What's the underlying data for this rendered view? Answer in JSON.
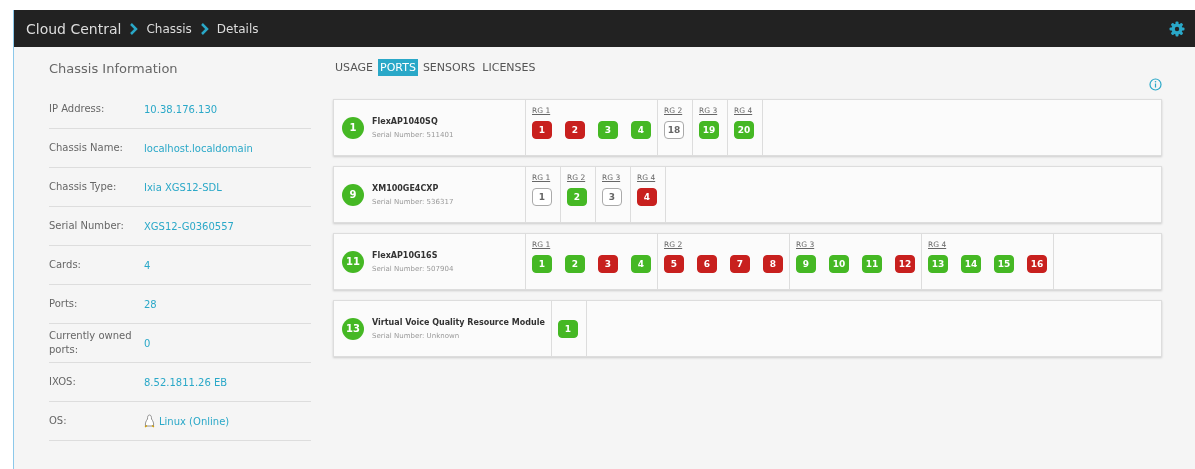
{
  "breadcrumb": [
    "Cloud Central",
    "Chassis",
    "Details"
  ],
  "info": {
    "title": "Chassis Information",
    "rows": [
      {
        "label": "IP Address:",
        "value": "10.38.176.130"
      },
      {
        "label": "Chassis Name:",
        "value": "localhost.localdomain"
      },
      {
        "label": "Chassis Type:",
        "value": "Ixia XGS12-SDL"
      },
      {
        "label": "Serial Number:",
        "value": "XGS12-G0360557"
      },
      {
        "label": "Cards:",
        "value": "4"
      },
      {
        "label": "Ports:",
        "value": "28"
      },
      {
        "label": "Currently owned ports:",
        "value": "0"
      },
      {
        "label": "IXOS:",
        "value": "8.52.1811.26 EB"
      },
      {
        "label": "OS:",
        "value": "Linux (Online)",
        "kind": "os"
      }
    ]
  },
  "tabs": [
    {
      "label": "USAGE",
      "selected": false
    },
    {
      "label": "PORTS",
      "selected": true
    },
    {
      "label": "SENSORS",
      "selected": false
    },
    {
      "label": "LICENSES",
      "selected": false
    }
  ],
  "cards": [
    {
      "slot": "1",
      "name": "FlexAP1040SQ",
      "serial": "Serial Number: 511401",
      "groups": [
        {
          "label": "RG 1",
          "ports": [
            {
              "number": "1",
              "kind": "down"
            },
            {
              "number": "2",
              "kind": "down"
            },
            {
              "number": "3",
              "kind": "up"
            },
            {
              "number": "4",
              "kind": "up"
            }
          ]
        },
        {
          "label": "RG 2",
          "ports": [
            {
              "number": "18",
              "kind": "idle"
            }
          ]
        },
        {
          "label": "RG 3",
          "ports": [
            {
              "number": "19",
              "kind": "up"
            }
          ]
        },
        {
          "label": "RG 4",
          "ports": [
            {
              "number": "20",
              "kind": "up"
            }
          ]
        }
      ]
    },
    {
      "slot": "9",
      "name": "XM100GE4CXP",
      "serial": "Serial Number: 536317",
      "groups": [
        {
          "label": "RG 1",
          "ports": [
            {
              "number": "1",
              "kind": "idle"
            }
          ]
        },
        {
          "label": "RG 2",
          "ports": [
            {
              "number": "2",
              "kind": "up"
            }
          ]
        },
        {
          "label": "RG 3",
          "ports": [
            {
              "number": "3",
              "kind": "idle"
            }
          ]
        },
        {
          "label": "RG 4",
          "ports": [
            {
              "number": "4",
              "kind": "down"
            }
          ]
        }
      ]
    },
    {
      "slot": "11",
      "name": "FlexAP10G16S",
      "serial": "Serial Number: 507904",
      "groups": [
        {
          "label": "RG 1",
          "ports": [
            {
              "number": "1",
              "kind": "up"
            },
            {
              "number": "2",
              "kind": "up"
            },
            {
              "number": "3",
              "kind": "down"
            },
            {
              "number": "4",
              "kind": "up"
            }
          ]
        },
        {
          "label": "RG 2",
          "ports": [
            {
              "number": "5",
              "kind": "down"
            },
            {
              "number": "6",
              "kind": "down"
            },
            {
              "number": "7",
              "kind": "down"
            },
            {
              "number": "8",
              "kind": "down"
            }
          ]
        },
        {
          "label": "RG 3",
          "ports": [
            {
              "number": "9",
              "kind": "up"
            },
            {
              "number": "10",
              "kind": "up"
            },
            {
              "number": "11",
              "kind": "up"
            },
            {
              "number": "12",
              "kind": "down"
            }
          ]
        },
        {
          "label": "RG 4",
          "ports": [
            {
              "number": "13",
              "kind": "up"
            },
            {
              "number": "14",
              "kind": "up"
            },
            {
              "number": "15",
              "kind": "up"
            },
            {
              "number": "16",
              "kind": "down"
            }
          ]
        }
      ]
    },
    {
      "slot": "13",
      "name": "Virtual Voice Quality Resource Module",
      "serial": "Serial Number: Unknown",
      "groups": [
        {
          "ports": [
            {
              "number": "1",
              "kind": "up"
            }
          ]
        }
      ]
    }
  ]
}
